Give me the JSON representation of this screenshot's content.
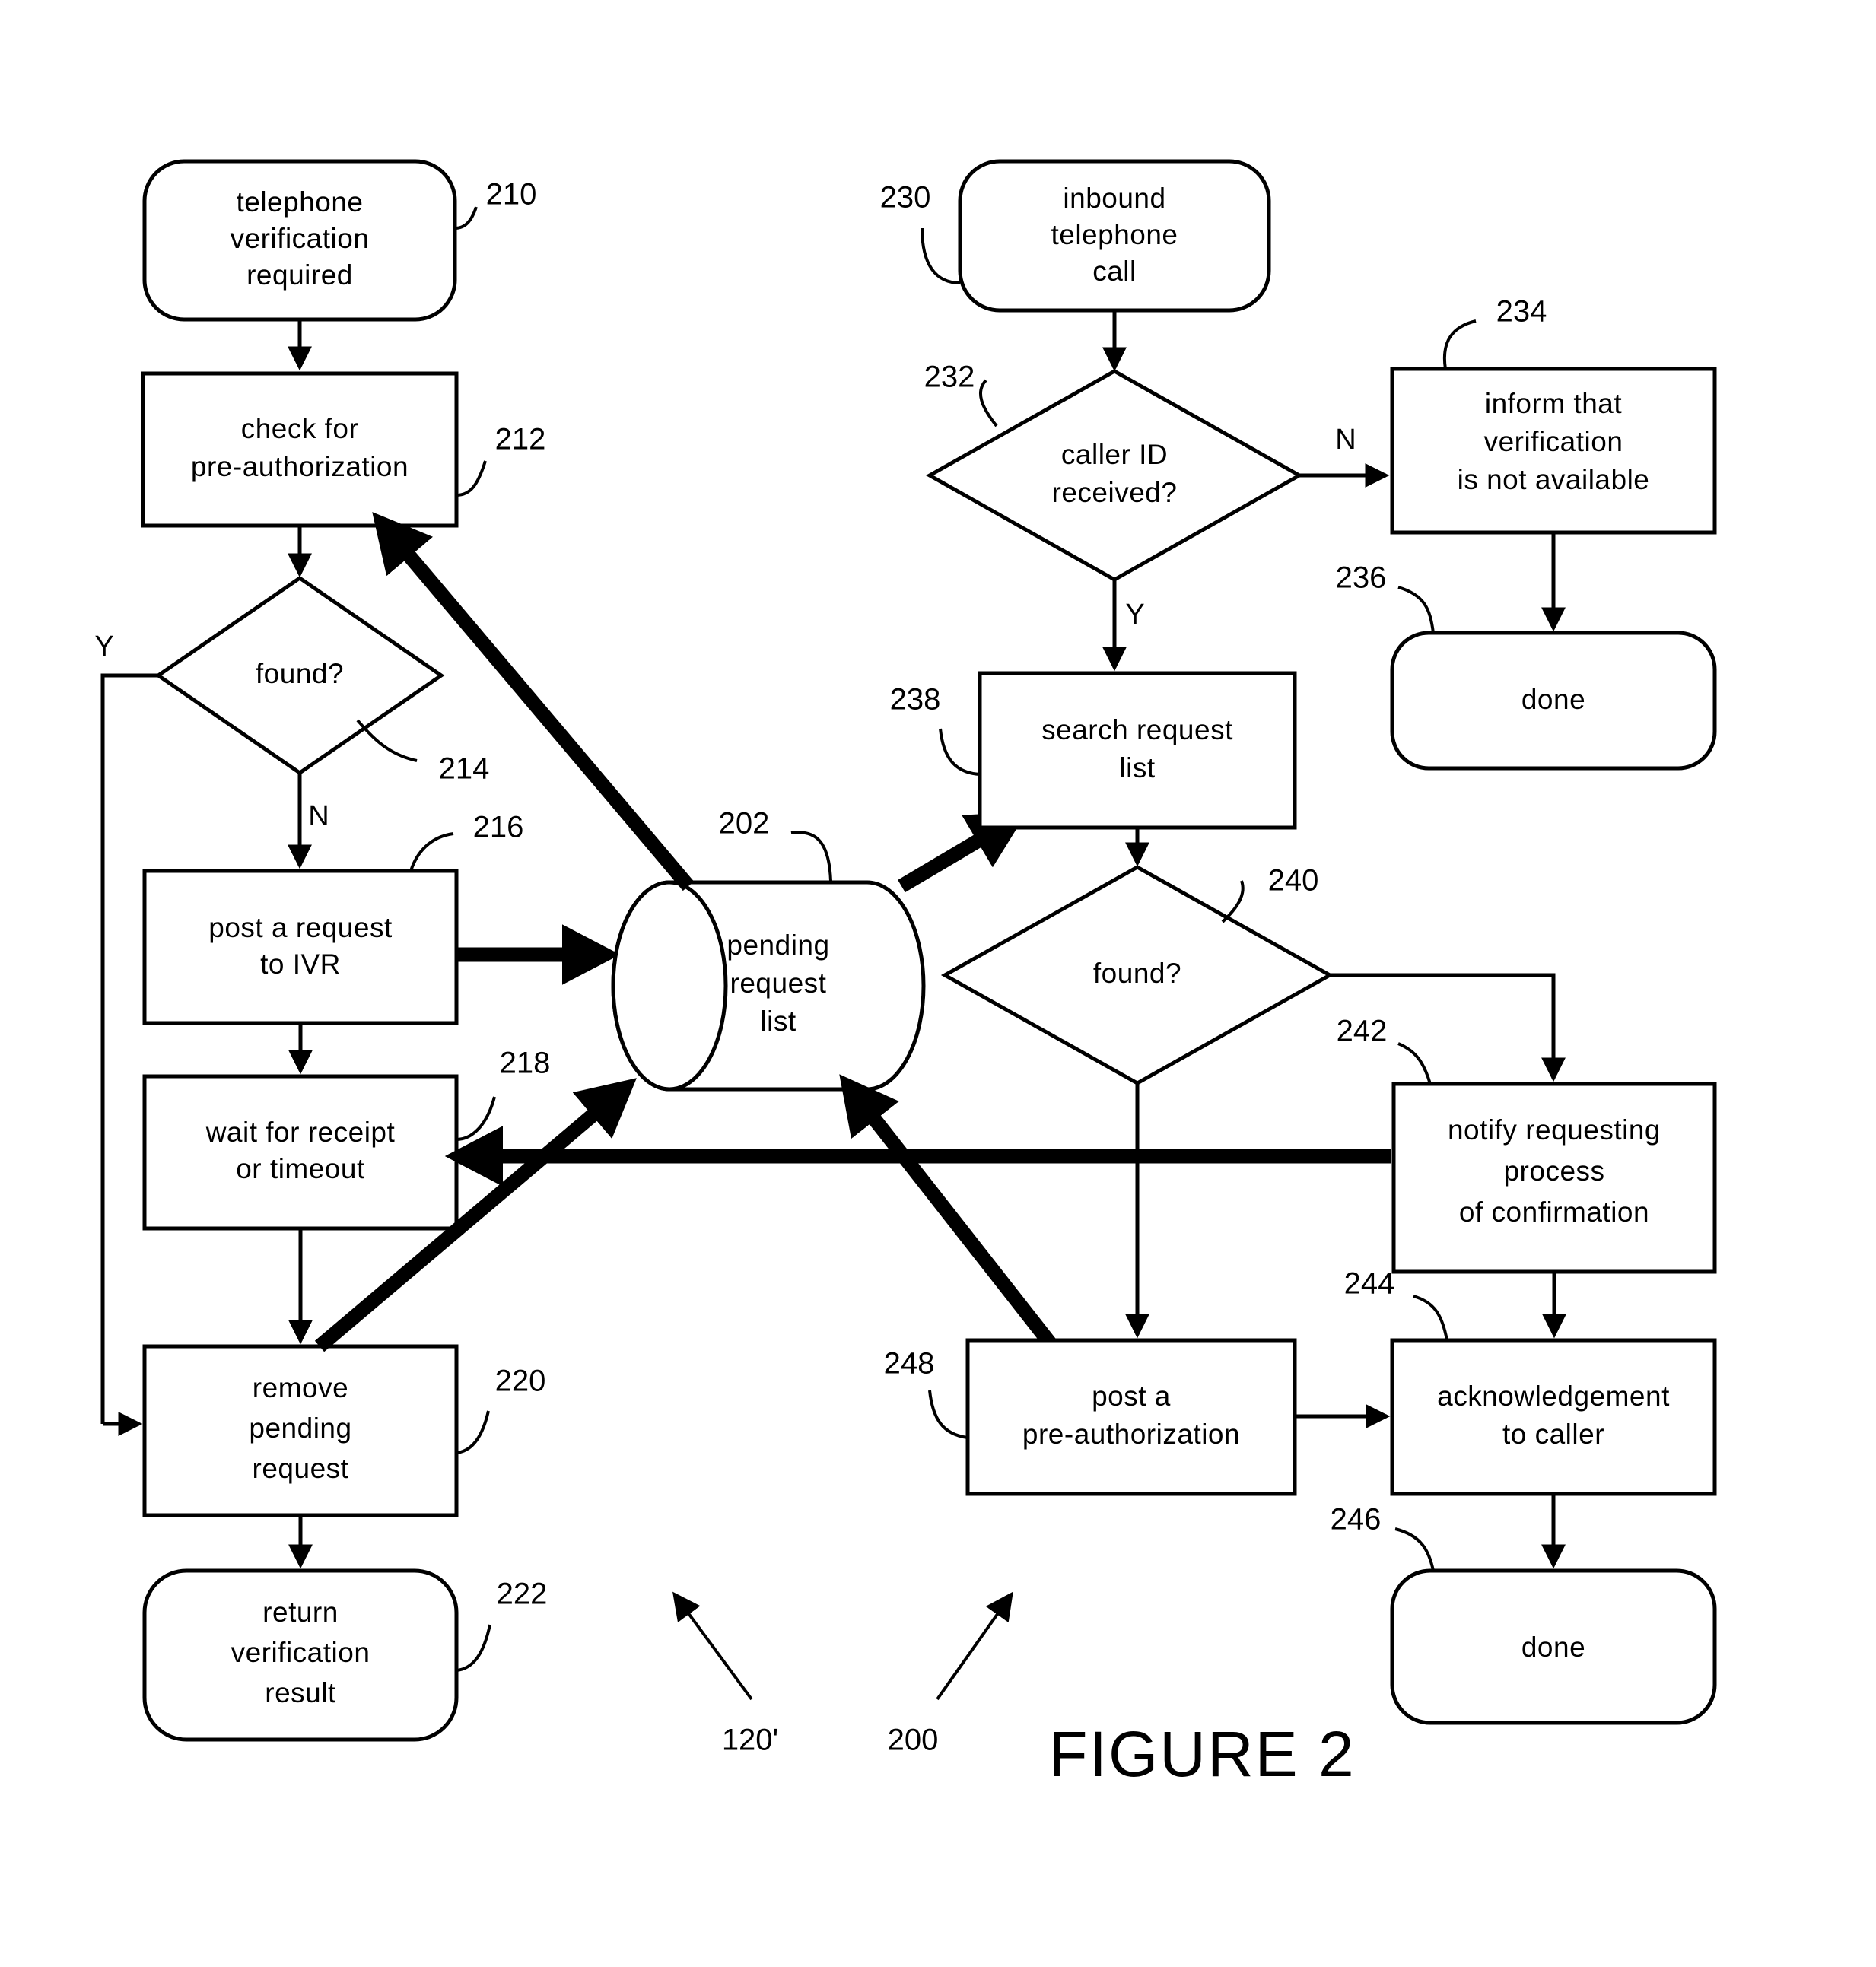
{
  "figure": {
    "caption": "FIGURE 2"
  },
  "nodes": [
    {
      "id": "210",
      "ref": "210",
      "shape": "rounded",
      "lines": [
        "telephone",
        "verification",
        "required"
      ]
    },
    {
      "id": "212",
      "ref": "212",
      "shape": "rect",
      "lines": [
        "check for",
        "pre-authorization"
      ]
    },
    {
      "id": "214",
      "ref": "214",
      "shape": "diamond",
      "lines": [
        "found?"
      ]
    },
    {
      "id": "216",
      "ref": "216",
      "shape": "rect",
      "lines": [
        "post a request",
        "to IVR"
      ]
    },
    {
      "id": "218",
      "ref": "218",
      "shape": "rect",
      "lines": [
        "wait for receipt",
        "or timeout"
      ]
    },
    {
      "id": "220",
      "ref": "220",
      "shape": "rect",
      "lines": [
        "remove",
        "pending",
        "request"
      ]
    },
    {
      "id": "222",
      "ref": "222",
      "shape": "rounded",
      "lines": [
        "return",
        "verification",
        "result"
      ]
    },
    {
      "id": "202",
      "ref": "202",
      "shape": "cylinder",
      "lines": [
        "pending",
        "request",
        "list"
      ]
    },
    {
      "id": "230",
      "ref": "230",
      "shape": "rounded",
      "lines": [
        "inbound",
        "telephone",
        "call"
      ]
    },
    {
      "id": "232",
      "ref": "232",
      "shape": "diamond",
      "lines": [
        "caller ID",
        "received?"
      ]
    },
    {
      "id": "234",
      "ref": "234",
      "shape": "rect",
      "lines": [
        "inform that",
        "verification",
        "is not available"
      ]
    },
    {
      "id": "236",
      "ref": "236",
      "shape": "rounded",
      "lines": [
        "done"
      ]
    },
    {
      "id": "238",
      "ref": "238",
      "shape": "rect",
      "lines": [
        "search request",
        "list"
      ]
    },
    {
      "id": "240",
      "ref": "240",
      "shape": "diamond",
      "lines": [
        "found?"
      ]
    },
    {
      "id": "242",
      "ref": "242",
      "shape": "rect",
      "lines": [
        "notify requesting",
        "process",
        "of confirmation"
      ]
    },
    {
      "id": "244",
      "ref": "244",
      "shape": "rect",
      "lines": [
        "acknowledgement",
        "to caller"
      ]
    },
    {
      "id": "246",
      "ref": "246",
      "shape": "rounded",
      "lines": [
        "done"
      ]
    },
    {
      "id": "248",
      "ref": "248",
      "shape": "rect",
      "lines": [
        "post a",
        "pre-authorization"
      ]
    }
  ],
  "edge_labels": {
    "found_yes_left": "Y",
    "found_no_left": "N",
    "callerid_no": "N",
    "callerid_yes": "Y"
  },
  "diagram_refs": {
    "left_flow": "120'",
    "right_flow": "200"
  },
  "colors": {
    "ink": "#000000",
    "paper": "#ffffff"
  }
}
